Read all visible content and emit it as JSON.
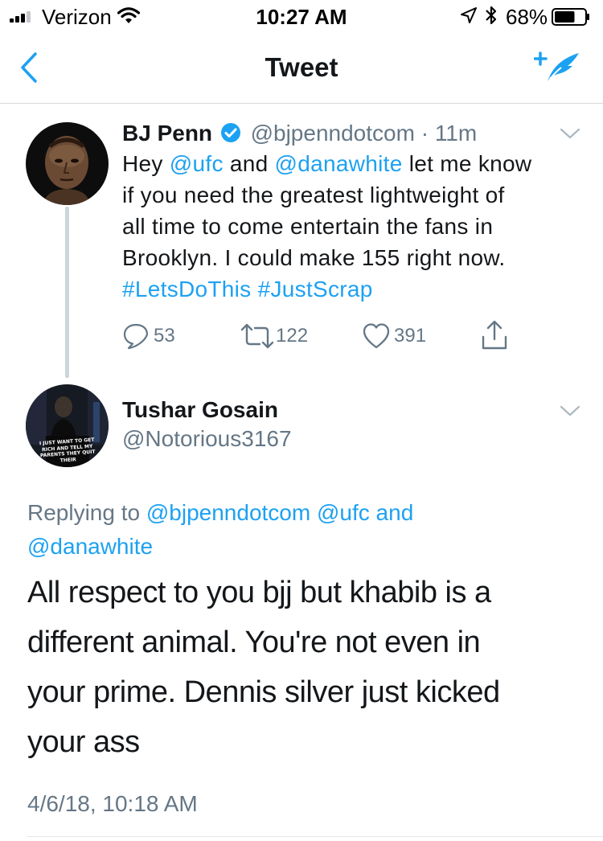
{
  "status_bar": {
    "carrier": "Verizon",
    "time": "10:27 AM",
    "battery": "68%",
    "battery_level": 0.68
  },
  "nav": {
    "title": "Tweet"
  },
  "tweet": {
    "name": "BJ Penn",
    "handle": "@bjpenndotcom",
    "sep": "·",
    "age": "11m",
    "line1": {
      "a": "Hey ",
      "b": "@ufc",
      "c": " and ",
      "d": "@danawhite",
      "e": " let me know"
    },
    "line2": "if you need the greatest lightweight of",
    "line3": "all time to come entertain the fans in",
    "line4": "Brooklyn. I could make 155 right now.",
    "line5": {
      "a": "#LetsDoThis",
      "b": "#JustScrap"
    },
    "replies": "53",
    "retweets": "122",
    "likes": "391"
  },
  "reply": {
    "name": "Tushar Gosain",
    "handle": "@Notorious3167",
    "avatar_text": "I JUST WANT TO GET RICH AND TELL MY PARENTS THEY QUIT THEIR",
    "replying_prefix": "Replying to ",
    "replying_to1": "@bjpenndotcom",
    "replying_to2": "@ufc",
    "replying_and": " and",
    "replying_to3": "@danawhite",
    "text1": "All respect to you bjj but khabib is a",
    "text2": "different animal. You're not even in",
    "text3": "your prime. Dennis silver just kicked",
    "text4": "your ass",
    "timestamp": "4/6/18, 10:18 AM"
  },
  "colors": {
    "accent": "#1da1f2",
    "muted": "#657786",
    "text": "#14171a",
    "verified": "#1da1f2"
  }
}
